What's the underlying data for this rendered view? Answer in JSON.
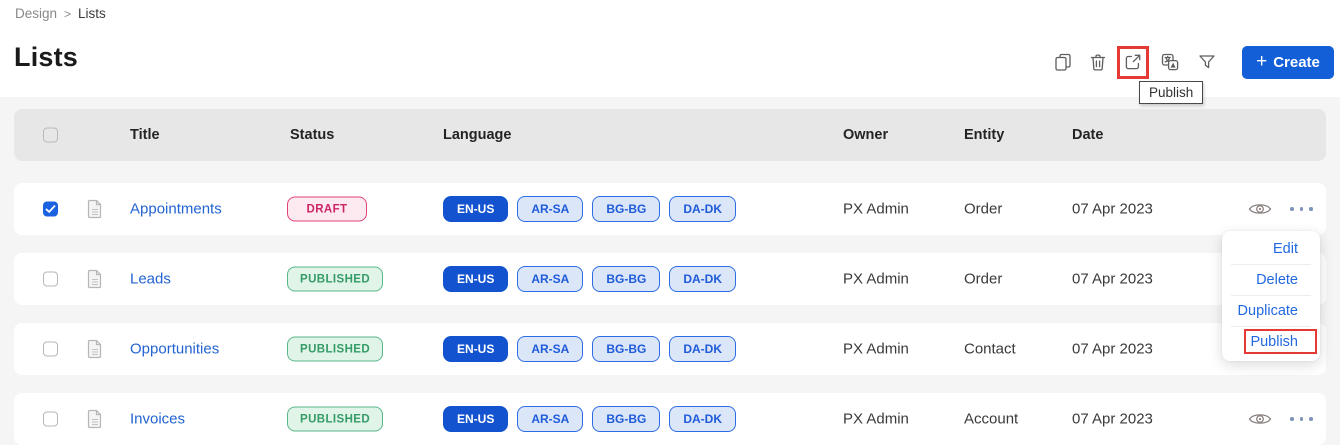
{
  "breadcrumb": {
    "items": [
      "Design",
      "Lists"
    ],
    "separator": ">"
  },
  "page": {
    "title": "Lists"
  },
  "toolbar": {
    "icons": [
      {
        "name": "copy-icon"
      },
      {
        "name": "delete-icon"
      },
      {
        "name": "publish-icon",
        "highlighted": true
      },
      {
        "name": "translate-icon"
      },
      {
        "name": "filter-icon"
      }
    ],
    "tooltip": "Publish",
    "create": {
      "plus": "+",
      "label": "Create"
    }
  },
  "table": {
    "columns": [
      "Title",
      "Status",
      "Language",
      "Owner",
      "Entity",
      "Date"
    ],
    "rows": [
      {
        "checked": true,
        "title": "Appointments",
        "status": "DRAFT",
        "status_class": "draft",
        "languages": [
          "EN-US",
          "AR-SA",
          "BG-BG",
          "DA-DK"
        ],
        "owner": "PX Admin",
        "entity": "Order",
        "date": "07 Apr 2023"
      },
      {
        "checked": false,
        "title": "Leads",
        "status": "PUBLISHED",
        "status_class": "published",
        "languages": [
          "EN-US",
          "AR-SA",
          "BG-BG",
          "DA-DK"
        ],
        "owner": "PX Admin",
        "entity": "Order",
        "date": "07 Apr 2023"
      },
      {
        "checked": false,
        "title": "Opportunities",
        "status": "PUBLISHED",
        "status_class": "published",
        "languages": [
          "EN-US",
          "AR-SA",
          "BG-BG",
          "DA-DK"
        ],
        "owner": "PX Admin",
        "entity": "Contact",
        "date": "07 Apr 2023"
      },
      {
        "checked": false,
        "title": "Invoices",
        "status": "PUBLISHED",
        "status_class": "published",
        "languages": [
          "EN-US",
          "AR-SA",
          "BG-BG",
          "DA-DK"
        ],
        "owner": "PX Admin",
        "entity": "Account",
        "date": "07 Apr 2023"
      }
    ]
  },
  "context_menu": {
    "items": [
      "Edit",
      "Delete",
      "Duplicate",
      "Publish"
    ],
    "highlighted": "Publish"
  },
  "colors": {
    "accent_blue": "#125fd8",
    "link_blue": "#2264d1",
    "menu_blue": "#2268e0",
    "primary_badge_blue": "#1353cf",
    "badge_outline_blue": "#2d6ce5",
    "draft_red": "#cc2565",
    "published_green": "#359b67",
    "highlight_red": "#e53935",
    "header_gray": "#e7e7e8",
    "page_gray": "#f5f5f6"
  }
}
